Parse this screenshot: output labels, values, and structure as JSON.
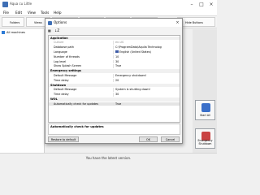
{
  "app": {
    "title": "Aqua cu Liltle"
  },
  "menu": [
    "File",
    "Edit",
    "View",
    "Tools",
    "Help"
  ],
  "toolbar": {
    "items": [
      {
        "label": "Folders",
        "color": "#3c83d6"
      },
      {
        "label": "Views",
        "color": "#5a9a3c"
      },
      {
        "label": "Schedule",
        "color": "#d88a2b"
      },
      {
        "label": "Options",
        "color": "#c24b4b"
      },
      {
        "label": "Events",
        "color": "#6b6bbf"
      },
      {
        "label": "Settings",
        "color": "#2f8f8f"
      },
      {
        "label": "Hide Buttons",
        "color": "#888888"
      }
    ]
  },
  "tree": {
    "root": "All machines"
  },
  "side_buttons": {
    "start_all": "Start All",
    "emergency": "Emergency Shutdown"
  },
  "status": {
    "text": "You have the latest version."
  },
  "dialog": {
    "title": "Options",
    "toolbar_labels": [
      "▦",
      "↓Z"
    ],
    "rows": [
      {
        "type": "cat",
        "key": "Application",
        "value": ""
      },
      {
        "type": "dim",
        "key": "Culture",
        "value": "en-US"
      },
      {
        "type": "row",
        "key": "Database path",
        "value": "C:\\ProgramData\\Aqulia Technolog"
      },
      {
        "type": "row",
        "key": "Language",
        "value": "English (United States)",
        "flag": true
      },
      {
        "type": "row",
        "key": "Number of threads",
        "value": "10"
      },
      {
        "type": "row",
        "key": "Log level",
        "value": "30"
      },
      {
        "type": "row",
        "key": "Show Splash Screen",
        "value": "True"
      },
      {
        "type": "cat",
        "key": "Emergency settings",
        "value": ""
      },
      {
        "type": "row",
        "key": "Default Message",
        "value": "Emergency shutdown!"
      },
      {
        "type": "row",
        "key": "Time delay",
        "value": "20"
      },
      {
        "type": "cat",
        "key": "Shutdown",
        "value": ""
      },
      {
        "type": "row",
        "key": "Default Message",
        "value": "System is shutting down!"
      },
      {
        "type": "row",
        "key": "Time delay",
        "value": "30"
      },
      {
        "type": "cat",
        "key": "WOL",
        "value": ""
      },
      {
        "type": "sel",
        "key": "Automatically check for updates",
        "value": "True"
      }
    ],
    "description": {
      "title": "Automatically check for updates"
    },
    "buttons": {
      "restore": "Restore to default",
      "ok": "OK",
      "cancel": "Cancel"
    }
  }
}
